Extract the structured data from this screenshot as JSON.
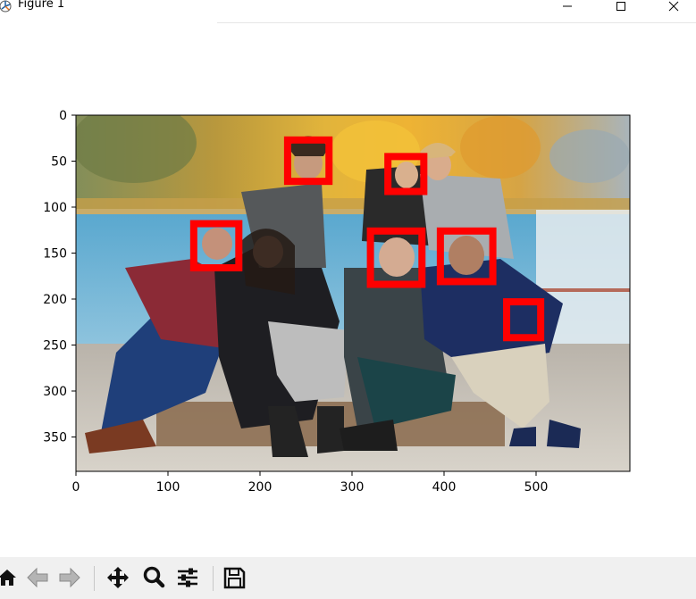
{
  "window": {
    "title": "Figure 1",
    "controls": [
      "minimize",
      "maximize",
      "close"
    ]
  },
  "plot": {
    "type": "image",
    "xlim": [
      0,
      600
    ],
    "ylim_inverted": [
      390,
      0
    ],
    "x_ticks": [
      "0",
      "100",
      "200",
      "300",
      "400",
      "500"
    ],
    "y_ticks": [
      "0",
      "50",
      "100",
      "150",
      "200",
      "250",
      "300",
      "350"
    ],
    "detections_color": "#ff0000",
    "detections": [
      {
        "x0": 230,
        "y0": 27,
        "x1": 275,
        "y1": 72
      },
      {
        "x0": 339,
        "y0": 45,
        "x1": 378,
        "y1": 83
      },
      {
        "x0": 128,
        "y0": 118,
        "x1": 177,
        "y1": 166
      },
      {
        "x0": 320,
        "y0": 126,
        "x1": 376,
        "y1": 184
      },
      {
        "x0": 396,
        "y0": 126,
        "x1": 453,
        "y1": 181
      },
      {
        "x0": 468,
        "y0": 203,
        "x1": 505,
        "y1": 242
      }
    ]
  },
  "toolbar": {
    "buttons": [
      "home-icon",
      "back-arrow-icon",
      "forward-arrow-icon",
      "pan-icon",
      "zoom-icon",
      "configure-subplots-icon",
      "save-icon"
    ]
  }
}
